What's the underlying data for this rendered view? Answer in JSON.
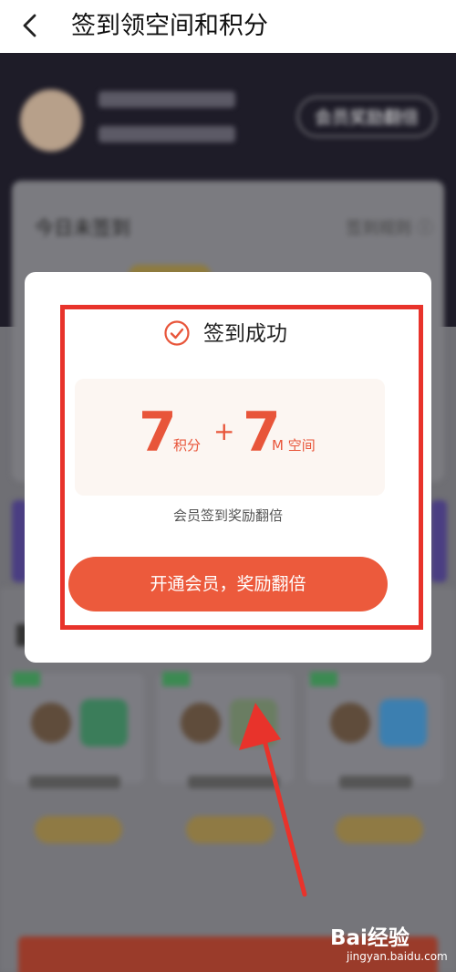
{
  "header": {
    "title": "签到领空间和积分"
  },
  "background": {
    "vip_button": "会员奖励翻倍",
    "card_title": "今日未签到",
    "rules_link": "签到规则"
  },
  "dialog": {
    "success_text": "签到成功",
    "points_value": "7",
    "points_unit": "积分",
    "plus": "+",
    "space_value": "7",
    "space_unit": "M 空间",
    "double_note": "会员签到奖励翻倍",
    "cta": "开通会员，奖励翻倍"
  },
  "watermark": {
    "brand": "Bai经验",
    "site": "jingyan.baidu.com"
  },
  "colors": {
    "accent": "#ec5a3c",
    "highlight_frame": "#e8332b",
    "dark_band": "#1e1c28"
  },
  "icons": {
    "back": "chevron-left-icon",
    "check": "check-circle-icon",
    "info": "info-icon",
    "arrow": "red-arrow-icon"
  }
}
